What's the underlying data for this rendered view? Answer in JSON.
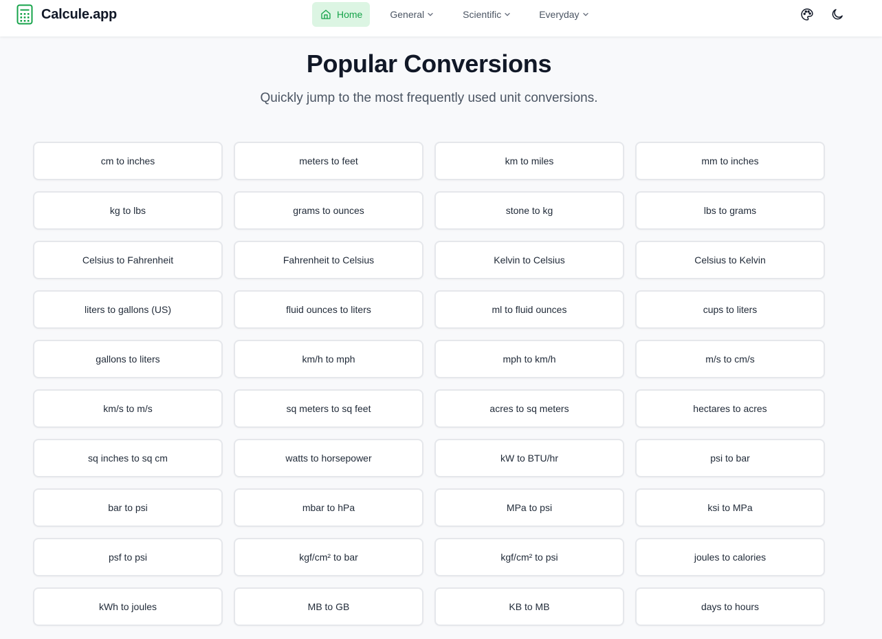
{
  "brand": {
    "name": "Calcule.app",
    "icon": "calculator-icon",
    "accent": "#16a34a"
  },
  "nav": {
    "home": "Home",
    "general": "General",
    "scientific": "Scientific",
    "everyday": "Everyday"
  },
  "actions": {
    "theme_icon": "palette-icon",
    "dark_mode_icon": "moon-icon"
  },
  "page": {
    "title": "Popular Conversions",
    "subtitle": "Quickly jump to the most frequently used unit conversions."
  },
  "conversions": [
    "cm to inches",
    "meters to feet",
    "km to miles",
    "mm to inches",
    "kg to lbs",
    "grams to ounces",
    "stone to kg",
    "lbs to grams",
    "Celsius to Fahrenheit",
    "Fahrenheit to Celsius",
    "Kelvin to Celsius",
    "Celsius to Kelvin",
    "liters to gallons (US)",
    "fluid ounces to liters",
    "ml to fluid ounces",
    "cups to liters",
    "gallons to liters",
    "km/h to mph",
    "mph to km/h",
    "m/s to cm/s",
    "km/s to m/s",
    "sq meters to sq feet",
    "acres to sq meters",
    "hectares to acres",
    "sq inches to sq cm",
    "watts to horsepower",
    "kW to BTU/hr",
    "psi to bar",
    "bar to psi",
    "mbar to hPa",
    "MPa to psi",
    "ksi to MPa",
    "psf to psi",
    "kgf/cm² to bar",
    "kgf/cm² to psi",
    "joules to calories",
    "kWh to joules",
    "MB to GB",
    "KB to MB",
    "days to hours"
  ]
}
